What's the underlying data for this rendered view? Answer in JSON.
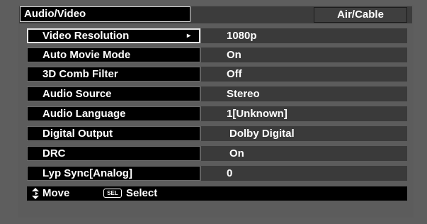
{
  "header": {
    "section_title": "Audio/Video",
    "input_source": "Air/Cable"
  },
  "menu": {
    "items": [
      {
        "label": "Video Resolution",
        "value": "1080p"
      },
      {
        "label": "Auto Movie Mode",
        "value": "On"
      },
      {
        "label": "3D Comb Filter",
        "value": "Off"
      },
      {
        "label": "Audio Source",
        "value": "Stereo"
      },
      {
        "label": "Audio Language",
        "value": "1[Unknown]"
      },
      {
        "label": "Digital Output",
        "value": "Dolby Digital"
      },
      {
        "label": "DRC",
        "value": "On"
      },
      {
        "label": "Lyp Sync[Analog]",
        "value": "0"
      }
    ],
    "selected_index": 0
  },
  "footer": {
    "move_label": "Move",
    "sel_key": "SEL",
    "select_label": "Select"
  },
  "icons": {
    "submenu": "chevron-right-icon",
    "move": "up-down-arrows-icon",
    "sel": "sel-key-icon"
  }
}
